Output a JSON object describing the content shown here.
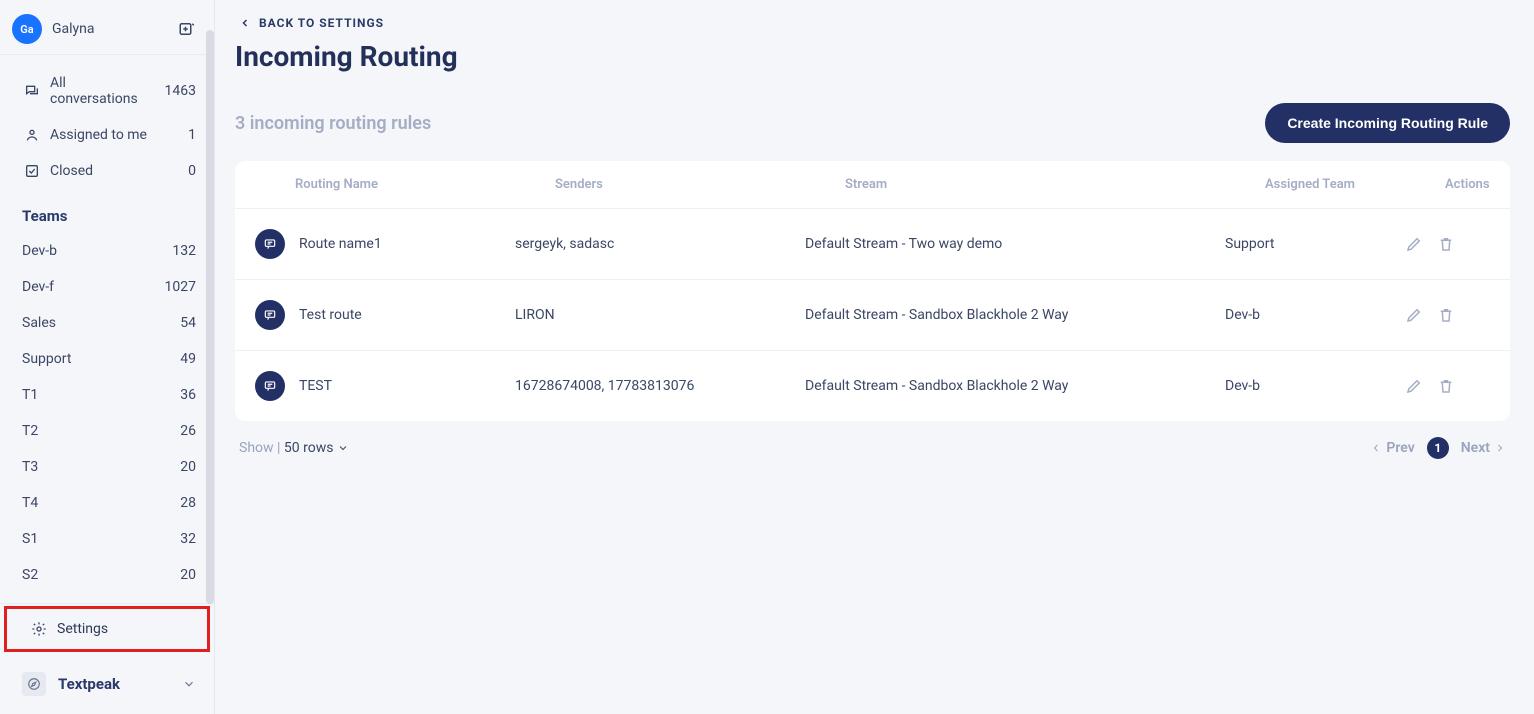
{
  "user": {
    "initials": "Ga",
    "name": "Galyna"
  },
  "sidebar": {
    "nav": [
      {
        "label": "All conversations",
        "count": "1463"
      },
      {
        "label": "Assigned to me",
        "count": "1"
      },
      {
        "label": "Closed",
        "count": "0"
      }
    ],
    "teams_header": "Teams",
    "teams": [
      {
        "name": "Dev-b",
        "count": "132"
      },
      {
        "name": "Dev-f",
        "count": "1027"
      },
      {
        "name": "Sales",
        "count": "54"
      },
      {
        "name": "Support",
        "count": "49"
      },
      {
        "name": "T1",
        "count": "36"
      },
      {
        "name": "T2",
        "count": "26"
      },
      {
        "name": "T3",
        "count": "20"
      },
      {
        "name": "T4",
        "count": "28"
      },
      {
        "name": "S1",
        "count": "32"
      },
      {
        "name": "S2",
        "count": "20"
      }
    ],
    "settings_label": "Settings",
    "workspace": "Textpeak"
  },
  "back_label": "BACK TO SETTINGS",
  "page_title": "Incoming Routing",
  "subhead": "3 incoming routing rules",
  "create_button": "Create Incoming Routing Rule",
  "columns": {
    "routing_name": "Routing Name",
    "senders": "Senders",
    "stream": "Stream",
    "team": "Assigned Team",
    "actions": "Actions"
  },
  "rows": [
    {
      "name": "Route name1",
      "senders": "sergeyk, sadasc",
      "stream": "Default Stream - Two way demo",
      "team": "Support"
    },
    {
      "name": "Test route",
      "senders": "LIRON",
      "stream": "Default Stream - Sandbox Blackhole 2 Way",
      "team": "Dev-b"
    },
    {
      "name": "TEST",
      "senders": "16728674008, 17783813076",
      "stream": "Default Stream - Sandbox Blackhole 2 Way",
      "team": "Dev-b"
    }
  ],
  "footer": {
    "show_label": "Show",
    "rows_label": "50 rows",
    "prev": "Prev",
    "next": "Next",
    "page": "1"
  }
}
